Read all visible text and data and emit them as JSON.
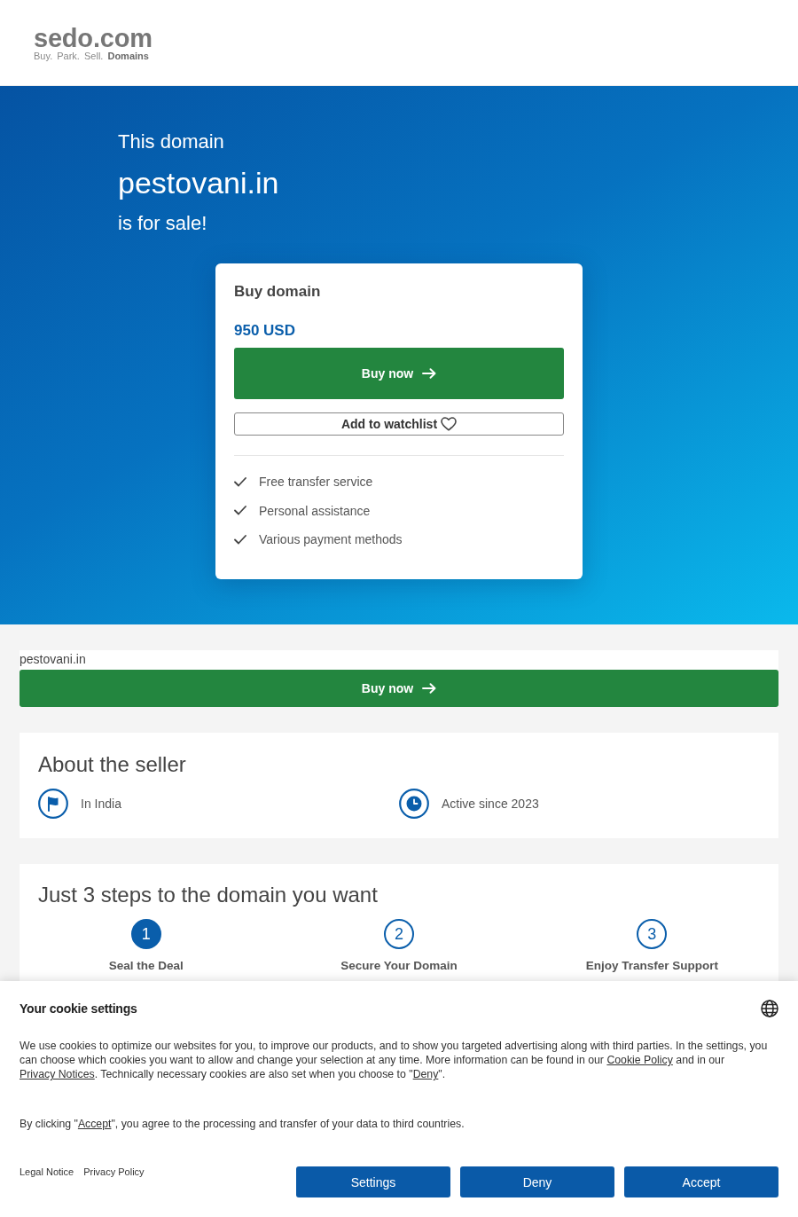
{
  "header": {
    "logo": {
      "wordmark": "sedo.com",
      "tagline": "Buy. Park. Sell. **Domains**"
    }
  },
  "hero": {
    "intro": "This domain",
    "domain": "pestovani.in",
    "outro": "is for sale!",
    "card": {
      "title": "Buy domain",
      "price": "950 USD",
      "buy_button": "Buy now",
      "watchlist_button": "Add to watchlist",
      "features": [
        "Free transfer service",
        "Personal assistance",
        "Various payment methods"
      ]
    }
  },
  "buy_strip": {
    "domain": "pestovani.in",
    "buy_button": "Buy now"
  },
  "seller": {
    "title": "About the seller",
    "facts": [
      {
        "kind": "location",
        "text": "In India"
      },
      {
        "kind": "since",
        "text": "Active since 2023"
      }
    ]
  },
  "steps": {
    "title": "Just 3 steps to the domain you want",
    "items": [
      {
        "number": "1",
        "label": "Seal the Deal",
        "active": true
      },
      {
        "number": "2",
        "label": "Secure Your Domain",
        "active": false
      },
      {
        "number": "3",
        "label": "Enjoy Transfer Support",
        "active": false
      }
    ]
  },
  "cookie_banner": {
    "title": "Your cookie settings",
    "paragraphs": [
      [
        {
          "kind": "text",
          "text": "We use cookies to optimize our websites for you, to improve our products, and to show you targeted advertising along with third parties. In the settings, you can choose which cookies you want to allow and change your selection at any time. More information can be found in our "
        },
        {
          "kind": "link",
          "text": "Cookie Policy"
        },
        {
          "kind": "text",
          "text": " and in our "
        },
        {
          "kind": "link",
          "text": "Privacy Notices"
        },
        {
          "kind": "text",
          "text": ". Technically necessary cookies are also set when you choose to \""
        },
        {
          "kind": "link",
          "text": "Deny"
        },
        {
          "kind": "text",
          "text": "\"."
        }
      ],
      [
        {
          "kind": "text",
          "text": "By clicking \""
        },
        {
          "kind": "link",
          "text": "Accept"
        },
        {
          "kind": "text",
          "text": "\", you agree to the processing and transfer of your data to third countries."
        }
      ]
    ],
    "footer_links": [
      "Legal Notice",
      "Privacy Policy"
    ],
    "buttons": [
      "Settings",
      "Deny",
      "Accept"
    ]
  }
}
